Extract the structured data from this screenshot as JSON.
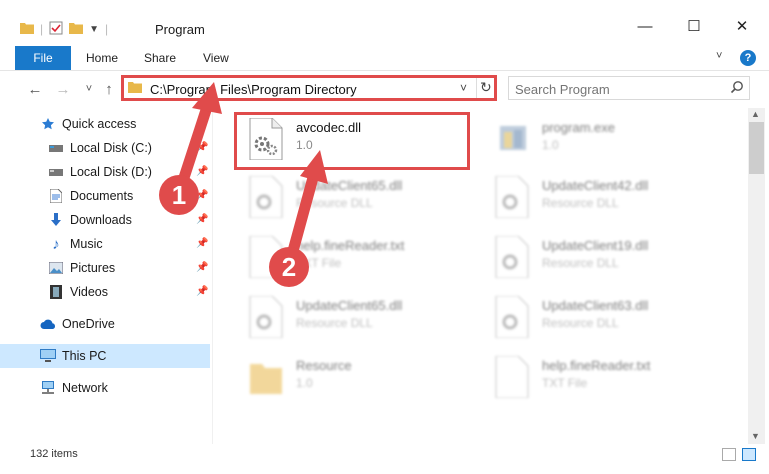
{
  "window": {
    "title": "Program",
    "minimize": "—",
    "maximize": "☐",
    "close": "✕"
  },
  "ribbon": {
    "file_tab": "File",
    "tabs": [
      "Home",
      "Share",
      "View"
    ],
    "help": "?"
  },
  "nav": {
    "back": "←",
    "forward": "→",
    "recent": "˅",
    "up": "↑"
  },
  "address": {
    "path": "C:\\Program Files\\Program Directory",
    "dropdown": "˅",
    "refresh": "↻"
  },
  "search": {
    "placeholder": "Search Program"
  },
  "sidebar": {
    "items": [
      {
        "label": "Quick access",
        "icon": "star-icon"
      },
      {
        "label": "Local Disk (C:)",
        "icon": "drive-icon"
      },
      {
        "label": "Local Disk (D:)",
        "icon": "drive-icon"
      },
      {
        "label": "Documents",
        "icon": "documents-icon"
      },
      {
        "label": "Downloads",
        "icon": "download-icon"
      },
      {
        "label": "Music",
        "icon": "music-icon"
      },
      {
        "label": "Pictures",
        "icon": "pictures-icon"
      },
      {
        "label": "Videos",
        "icon": "videos-icon"
      },
      {
        "label": "OneDrive",
        "icon": "cloud-icon"
      },
      {
        "label": "This PC",
        "icon": "computer-icon"
      },
      {
        "label": "Network",
        "icon": "network-icon"
      }
    ]
  },
  "files": [
    {
      "name": "avcodec.dll",
      "sub": "1.0"
    },
    {
      "name": "program.exe",
      "sub": "1.0"
    },
    {
      "name": "UpdateClient65.dll",
      "sub": "Resource DLL"
    },
    {
      "name": "UpdateClient42.dll",
      "sub": "Resource DLL"
    },
    {
      "name": "help.fineReader.txt",
      "sub": "TXT File"
    },
    {
      "name": "UpdateClient19.dll",
      "sub": "Resource DLL"
    },
    {
      "name": "UpdateClient65.dll",
      "sub": "Resource DLL"
    },
    {
      "name": "UpdateClient63.dll",
      "sub": "Resource DLL"
    },
    {
      "name": "Resource",
      "sub": "1.0"
    },
    {
      "name": "help.fineReader.txt",
      "sub": "TXT File"
    }
  ],
  "status": {
    "count": "132 items"
  },
  "annotations": {
    "step1": "1",
    "step2": "2"
  },
  "colors": {
    "accent": "#1979ca",
    "highlight": "#e04b4b",
    "selected": "#cde8ff"
  }
}
